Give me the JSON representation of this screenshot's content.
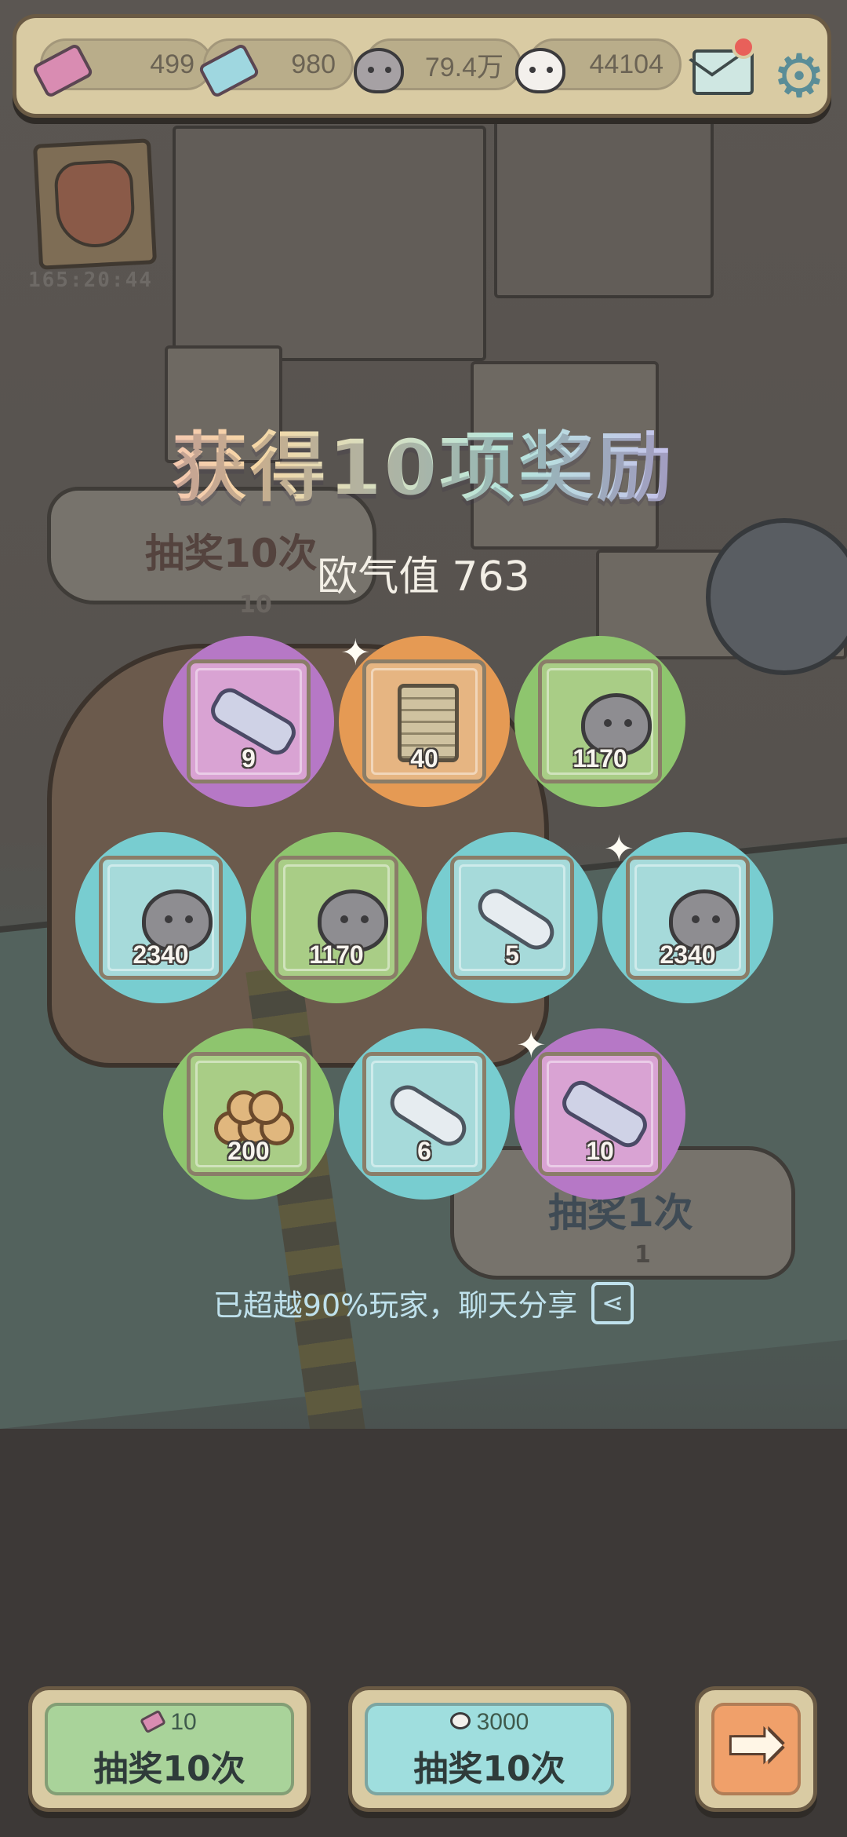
{
  "topbar": {
    "tickets_pink": "499",
    "tickets_blue": "980",
    "ghost_grey": "79.4万",
    "ghost_white": "44104",
    "icons": [
      "pink-ticket-icon",
      "blue-ticket-icon",
      "grey-ghost-icon",
      "white-ghost-icon",
      "mail-icon",
      "gear-icon"
    ]
  },
  "event": {
    "timer": "165:20:44"
  },
  "background": {
    "draw10_label": "抽奖10次",
    "draw10_cost": "10",
    "draw1_label": "抽奖1次",
    "draw1_cost": "1"
  },
  "rewards": {
    "title": "获得10项奖励",
    "luck_label": "欧气值",
    "luck_value": "763",
    "items": [
      {
        "name": "cannon",
        "qty": "9",
        "color": "purple"
      },
      {
        "name": "ancient-tablet",
        "qty": "40",
        "color": "orange"
      },
      {
        "name": "grey-ghost",
        "qty": "1170",
        "color": "green"
      },
      {
        "name": "grey-ghost",
        "qty": "2340",
        "color": "teal"
      },
      {
        "name": "grey-ghost",
        "qty": "1170",
        "color": "green"
      },
      {
        "name": "scroll",
        "qty": "5",
        "color": "teal"
      },
      {
        "name": "grey-ghost",
        "qty": "2340",
        "color": "teal"
      },
      {
        "name": "logs",
        "qty": "200",
        "color": "green"
      },
      {
        "name": "scroll",
        "qty": "6",
        "color": "teal"
      },
      {
        "name": "cannon",
        "qty": "10",
        "color": "purple"
      }
    ],
    "share_text": "已超越90%玩家，聊天分享"
  },
  "buttons": {
    "ticket_draw": {
      "cost": "10",
      "label": "抽奖10次"
    },
    "ghost_draw": {
      "cost": "3000",
      "label": "抽奖10次"
    },
    "next_icon": "right-arrow-icon"
  }
}
